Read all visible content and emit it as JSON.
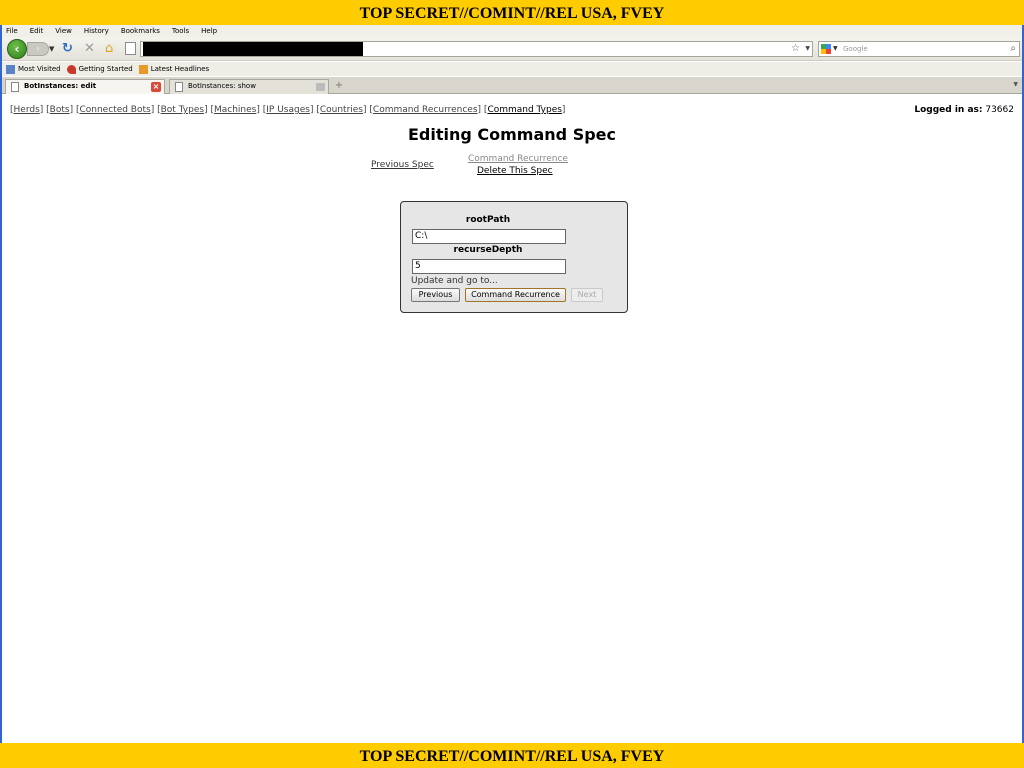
{
  "banner": {
    "top": "TOP SECRET//COMINT//REL USA, FVEY",
    "bottom": "TOP SECRET//COMINT//REL USA, FVEY"
  },
  "menu": [
    "File",
    "Edit",
    "View",
    "History",
    "Bookmarks",
    "Tools",
    "Help"
  ],
  "search": {
    "placeholder": "Google"
  },
  "bookmarks": [
    "Most Visited",
    "Getting Started",
    "Latest Headlines"
  ],
  "tabs": [
    {
      "label": "BotInstances: edit"
    },
    {
      "label": "BotInstances: show"
    }
  ],
  "nav": {
    "links": [
      "Herds",
      "Bots",
      "Connected Bots",
      "Bot Types",
      "Machines",
      "IP Usages",
      "Countries",
      "Command Recurrences",
      "Command Types"
    ],
    "login_label": "Logged in as:",
    "login_user": "73662"
  },
  "page": {
    "title": "Editing Command Spec",
    "prev_spec": "Previous Spec",
    "command_recurrence": "Command Recurrence",
    "delete_spec": "Delete This Spec"
  },
  "form": {
    "root_label": "rootPath",
    "root_value": "C:\\",
    "depth_label": "recurseDepth",
    "depth_value": "5",
    "update_text": "Update and go to...",
    "btn_previous": "Previous",
    "btn_recurrence": "Command Recurrence",
    "btn_next": "Next"
  }
}
